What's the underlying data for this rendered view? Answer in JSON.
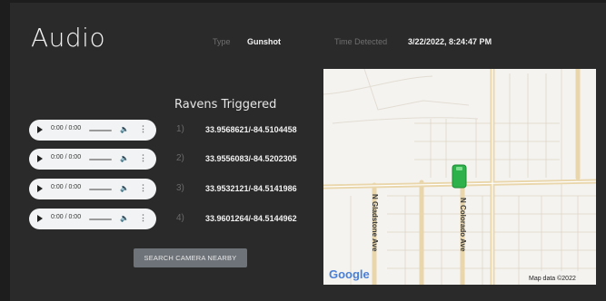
{
  "header": {
    "title": "Audio",
    "type_label": "Type",
    "type_value": "Gunshot",
    "time_label": "Time Detected",
    "time_value": "3/22/2022, 8:24:47 PM"
  },
  "ravens": {
    "title": "Ravens Triggered",
    "items": [
      {
        "index": "1)",
        "coords": "33.9568621/-84.5104458",
        "audio_time": "0:00 / 0:00"
      },
      {
        "index": "2)",
        "coords": "33.9556083/-84.5202305",
        "audio_time": "0:00 / 0:00"
      },
      {
        "index": "3)",
        "coords": "33.9532121/-84.5141986",
        "audio_time": "0:00 / 0:00"
      },
      {
        "index": "4)",
        "coords": "33.9601264/-84.5144962",
        "audio_time": "0:00 / 0:00"
      }
    ]
  },
  "actions": {
    "search_camera": "SEARCH CAMERA NEARBY"
  },
  "map": {
    "street_1": "N Gladstone Ave",
    "street_2": "N Colorado Ave",
    "logo": "Google",
    "attribution": "Map data ©2022",
    "marker_color": "#2db14a",
    "road_color": "#e9d6ab"
  },
  "colors": {
    "background": "#2a2a2a",
    "button": "#6e7379"
  }
}
